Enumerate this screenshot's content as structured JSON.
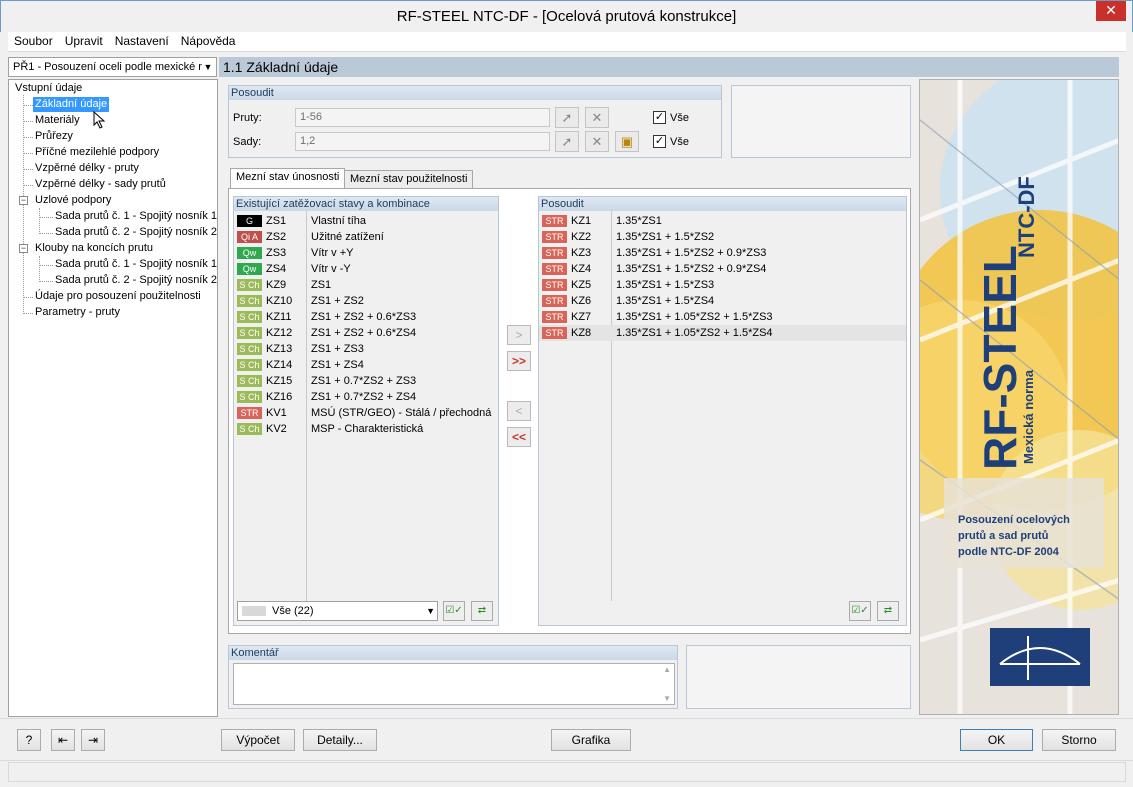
{
  "window": {
    "title": "RF-STEEL NTC-DF - [Ocelová prutová konstrukce]",
    "close_symbol": "✕"
  },
  "menu": [
    "Soubor",
    "Upravit",
    "Nastavení",
    "Nápověda"
  ],
  "case_select": {
    "value": "PŘ1 - Posouzení oceli podle mexické r"
  },
  "nav": {
    "root": "Vstupní údaje",
    "items": [
      "Základní údaje",
      "Materiály",
      "Průřezy",
      "Příčné mezilehlé podpory",
      "Vzpěrné délky - pruty",
      "Vzpěrné délky - sady prutů",
      "Uzlové podpory",
      "Sada prutů č. 1 - Spojitý nosník 1",
      "Sada prutů č. 2 - Spojitý nosník 2",
      "Klouby na koncích prutu",
      "Sada prutů č. 1 - Spojitý nosník 1",
      "Sada prutů č. 2 - Spojitý nosník 2",
      "Údaje pro posouzení použitelnosti",
      "Parametry - pruty"
    ]
  },
  "header": "1.1 Základní údaje",
  "posoudit": {
    "title": "Posoudit",
    "pruty_label": "Pruty:",
    "pruty_value": "1-56",
    "sady_label": "Sady:",
    "sady_value": "1,2",
    "vse": "Vše"
  },
  "tabs": [
    "Mezní stav únosnosti",
    "Mezní stav použitelnosti"
  ],
  "existing": {
    "title": "Existující zatěžovací stavy a kombinace",
    "filter": "Vše (22)",
    "rows": [
      {
        "badge": "G",
        "color": "#000000",
        "id": "ZS1",
        "desc": "Vlastní tíha"
      },
      {
        "badge": "Qi A",
        "color": "#c0504d",
        "id": "ZS2",
        "desc": "Užitné zatížení"
      },
      {
        "badge": "Qw",
        "color": "#2fa84f",
        "id": "ZS3",
        "desc": "Vítr v +Y"
      },
      {
        "badge": "Qw",
        "color": "#2fa84f",
        "id": "ZS4",
        "desc": "Vítr v -Y"
      },
      {
        "badge": "S Ch",
        "color": "#9bbb59",
        "id": "KZ9",
        "desc": "ZS1"
      },
      {
        "badge": "S Ch",
        "color": "#9bbb59",
        "id": "KZ10",
        "desc": "ZS1 + ZS2"
      },
      {
        "badge": "S Ch",
        "color": "#9bbb59",
        "id": "KZ11",
        "desc": "ZS1 + ZS2 + 0.6*ZS3"
      },
      {
        "badge": "S Ch",
        "color": "#9bbb59",
        "id": "KZ12",
        "desc": "ZS1 + ZS2 + 0.6*ZS4"
      },
      {
        "badge": "S Ch",
        "color": "#9bbb59",
        "id": "KZ13",
        "desc": "ZS1 + ZS3"
      },
      {
        "badge": "S Ch",
        "color": "#9bbb59",
        "id": "KZ14",
        "desc": "ZS1 + ZS4"
      },
      {
        "badge": "S Ch",
        "color": "#9bbb59",
        "id": "KZ15",
        "desc": "ZS1 + 0.7*ZS2 + ZS3"
      },
      {
        "badge": "S Ch",
        "color": "#9bbb59",
        "id": "KZ16",
        "desc": "ZS1 + 0.7*ZS2 + ZS4"
      },
      {
        "badge": "STR",
        "color": "#d9645a",
        "id": "KV1",
        "desc": "MSÚ (STR/GEO) - Stálá / přechodná"
      },
      {
        "badge": "S Ch",
        "color": "#9bbb59",
        "id": "KV2",
        "desc": "MSP - Charakteristická"
      }
    ]
  },
  "selected": {
    "title": "Posoudit",
    "rows": [
      {
        "badge": "STR",
        "id": "KZ1",
        "desc": "1.35*ZS1"
      },
      {
        "badge": "STR",
        "id": "KZ2",
        "desc": "1.35*ZS1 + 1.5*ZS2"
      },
      {
        "badge": "STR",
        "id": "KZ3",
        "desc": "1.35*ZS1 + 1.5*ZS2 + 0.9*ZS3"
      },
      {
        "badge": "STR",
        "id": "KZ4",
        "desc": "1.35*ZS1 + 1.5*ZS2 + 0.9*ZS4"
      },
      {
        "badge": "STR",
        "id": "KZ5",
        "desc": "1.35*ZS1 + 1.5*ZS3"
      },
      {
        "badge": "STR",
        "id": "KZ6",
        "desc": "1.35*ZS1 + 1.5*ZS4"
      },
      {
        "badge": "STR",
        "id": "KZ7",
        "desc": "1.35*ZS1 + 1.05*ZS2 + 1.5*ZS3"
      },
      {
        "badge": "STR",
        "id": "KZ8",
        "desc": "1.35*ZS1 + 1.05*ZS2 + 1.5*ZS4"
      }
    ]
  },
  "transfer": {
    "add": ">",
    "add_all": ">>",
    "remove": "<",
    "remove_all": "<<"
  },
  "comment": {
    "title": "Komentář"
  },
  "logo": {
    "product": "RF-STEEL",
    "module": "NTC-DF",
    "subtitle": "Mexická norma",
    "description_lines": [
      "Posouzení ocelových",
      "prutů a sad prutů",
      "podle NTC-DF 2004"
    ]
  },
  "buttons": {
    "calc": "Výpočet",
    "details": "Detaily...",
    "graphics": "Grafika",
    "ok": "OK",
    "cancel": "Storno"
  }
}
